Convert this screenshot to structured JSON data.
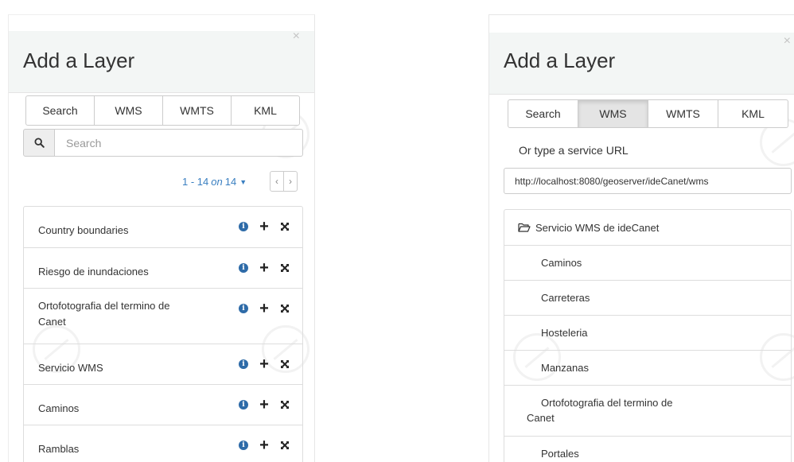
{
  "left": {
    "title": "Add a Layer",
    "close": "×",
    "tabs": [
      "Search",
      "WMS",
      "WMTS",
      "KML"
    ],
    "search_placeholder": "Search",
    "pager": {
      "range": "1 - 14",
      "on": "on",
      "total": "14"
    },
    "layers": [
      {
        "line1": "Country boundaries",
        "line2": ""
      },
      {
        "line1": "Riesgo de inundaciones",
        "line2": ""
      },
      {
        "line1": "Ortofotografia del termino de",
        "line2": "Canet"
      },
      {
        "line1": "Servicio WMS",
        "line2": ""
      },
      {
        "line1": "Caminos",
        "line2": ""
      },
      {
        "line1": "Ramblas",
        "line2": ""
      }
    ]
  },
  "right": {
    "title": "Add a Layer",
    "close": "×",
    "tabs": [
      "Search",
      "WMS",
      "WMTS",
      "KML"
    ],
    "active_tab": "WMS",
    "url_label": "Or type a service URL",
    "url_value": "http://localhost:8080/geoserver/ideCanet/wms",
    "service_name": "Servicio WMS de ideCanet",
    "layers": [
      "Caminos",
      "Carreteras",
      "Hosteleria",
      "Manzanas"
    ],
    "multi_layer": {
      "line1": "Ortofotografia del termino de",
      "line2": "Canet"
    },
    "last_layer": "Portales"
  },
  "colors": {
    "link": "#3a7fc1",
    "info": "#2e6ba8",
    "header_bg": "#f3f6f5"
  }
}
